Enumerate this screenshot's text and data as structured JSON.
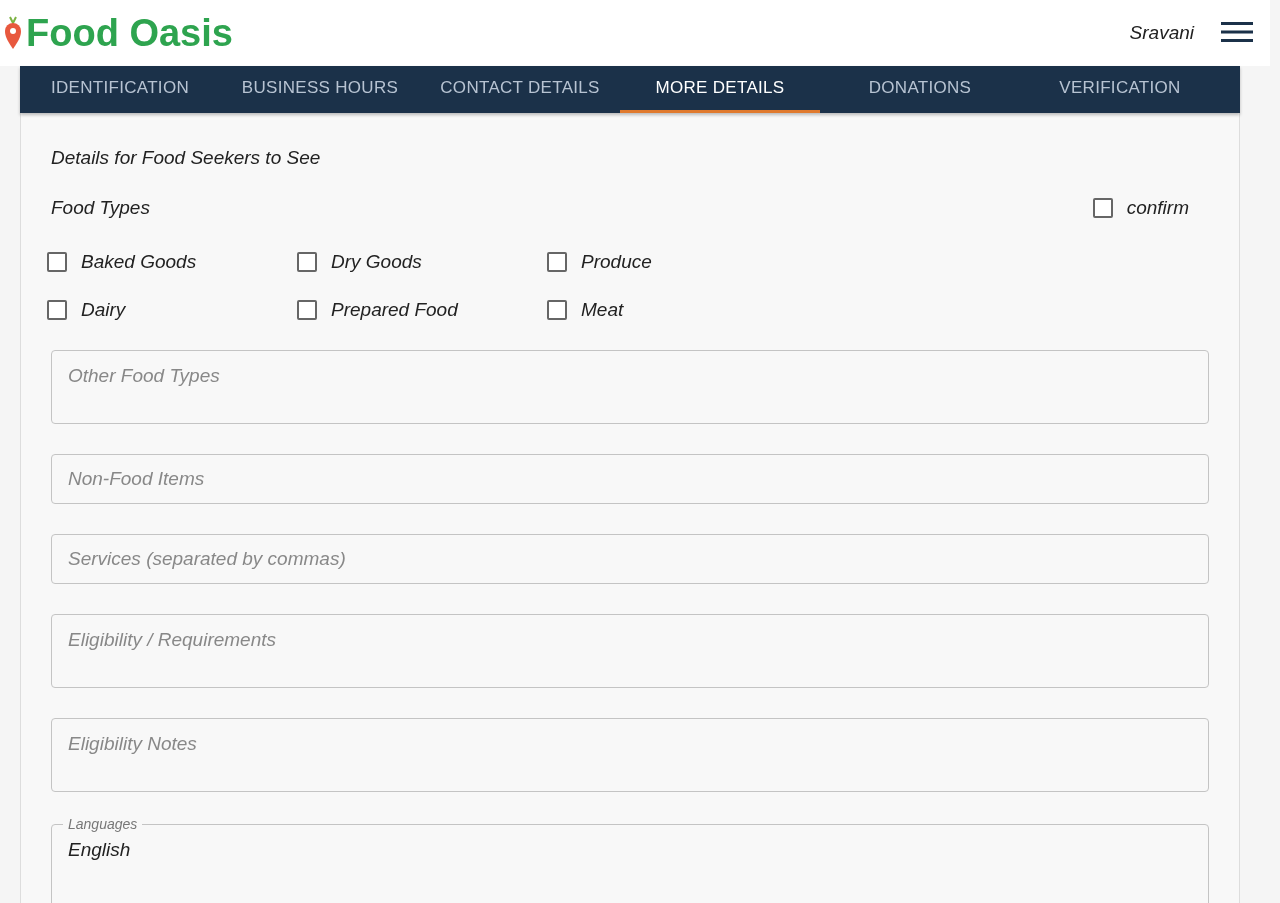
{
  "header": {
    "brand": "Food Oasis",
    "user": "Sravani"
  },
  "tabs": [
    {
      "label": "IDENTIFICATION",
      "selected": false
    },
    {
      "label": "BUSINESS HOURS",
      "selected": false
    },
    {
      "label": "CONTACT DETAILS",
      "selected": false
    },
    {
      "label": "MORE DETAILS",
      "selected": true
    },
    {
      "label": "DONATIONS",
      "selected": false
    },
    {
      "label": "VERIFICATION",
      "selected": false
    }
  ],
  "section_title": "Details for Food Seekers to See",
  "food_types": {
    "label": "Food Types",
    "confirm": {
      "label": "confirm",
      "checked": false
    },
    "options": [
      {
        "label": "Baked Goods",
        "checked": false
      },
      {
        "label": "Dry Goods",
        "checked": false
      },
      {
        "label": "Produce",
        "checked": false
      },
      {
        "label": "Dairy",
        "checked": false
      },
      {
        "label": "Prepared Food",
        "checked": false
      },
      {
        "label": "Meat",
        "checked": false
      }
    ]
  },
  "fields": [
    {
      "kind": "multiline",
      "placeholder": "Other Food Types"
    },
    {
      "kind": "single",
      "placeholder": "Non-Food Items"
    },
    {
      "kind": "single",
      "placeholder": "Services (separated by commas)"
    },
    {
      "kind": "multiline",
      "placeholder": "Eligibility / Requirements"
    },
    {
      "kind": "multiline",
      "placeholder": "Eligibility Notes"
    },
    {
      "kind": "labeled",
      "label": "Languages",
      "value": "English"
    }
  ]
}
